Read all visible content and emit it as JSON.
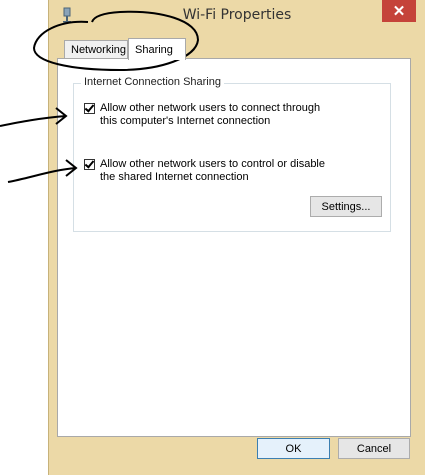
{
  "window": {
    "title": "Wi-Fi Properties",
    "close_glyph": "✕"
  },
  "tabs": [
    {
      "label": "Networking",
      "active": false
    },
    {
      "label": "Sharing",
      "active": true
    }
  ],
  "sharing": {
    "group_title": "Internet Connection Sharing",
    "options": [
      {
        "label": "Allow other network users to connect through this computer's Internet connection",
        "checked": true
      },
      {
        "label": "Allow other network users to control or disable the shared Internet connection",
        "checked": true
      }
    ],
    "settings_label": "Settings..."
  },
  "footer": {
    "ok_label": "OK",
    "cancel_label": "Cancel"
  },
  "icons": {
    "app": "wifi-adapter-icon",
    "close": "close-icon",
    "check": "checkmark-icon"
  },
  "colors": {
    "frame": "#ecd9a7",
    "close": "#c5433a",
    "ink": "#000000"
  }
}
